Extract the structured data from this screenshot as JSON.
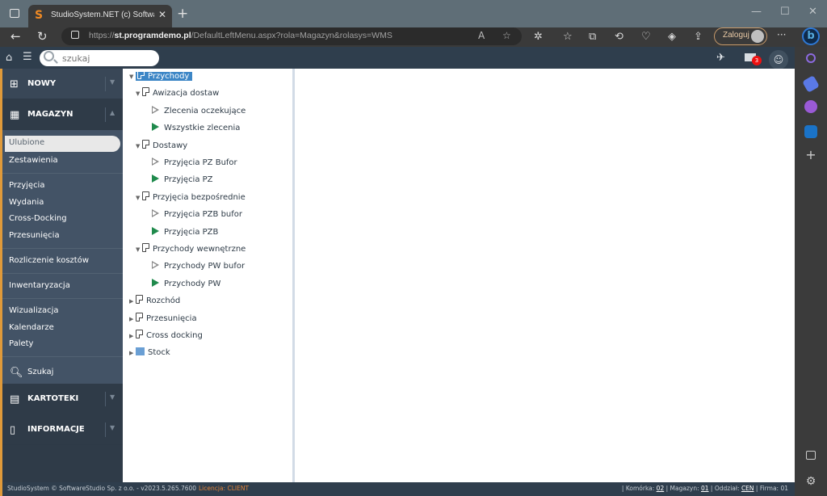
{
  "browser": {
    "tab_title": "StudioSystem.NET (c) SoftwareSt",
    "url_scheme": "https://",
    "url_host": "st.programdemo.pl",
    "url_path": "/DefaultLeftMenu.aspx?rola=Magazyn&rolasys=WMS",
    "login_label": "Zaloguj"
  },
  "app": {
    "search_placeholder": "szukaj",
    "mail_count": "3"
  },
  "menu": {
    "sections": {
      "nowy": "NOWY",
      "magazyn": "MAGAZYN",
      "szukaj": "Szukaj",
      "kartoteki": "KARTOTEKI",
      "informacje": "INFORMACJE"
    },
    "items": [
      "Ulubione",
      "Zestawienia",
      "Przyjęcia",
      "Wydania",
      "Cross-Docking",
      "Przesunięcia",
      "Rozliczenie kosztów",
      "Inwentaryzacja",
      "Wizualizacja",
      "Kalendarze",
      "Palety"
    ]
  },
  "tree": [
    {
      "label": "Przychody",
      "type": "folder",
      "level": 0,
      "expanded": true,
      "selected": true
    },
    {
      "label": "Awizacja dostaw",
      "type": "folder",
      "level": 1,
      "expanded": true
    },
    {
      "label": "Zlecenia oczekujące",
      "type": "open",
      "level": 2
    },
    {
      "label": "Wszystkie zlecenia",
      "type": "filled",
      "level": 2
    },
    {
      "label": "Dostawy",
      "type": "folder",
      "level": 1,
      "expanded": true
    },
    {
      "label": "Przyjęcia PZ Bufor",
      "type": "open",
      "level": 2
    },
    {
      "label": "Przyjęcia PZ",
      "type": "filled",
      "level": 2
    },
    {
      "label": "Przyjęcia bezpośrednie",
      "type": "folder",
      "level": 1,
      "expanded": true
    },
    {
      "label": "Przyjęcia PZB bufor",
      "type": "open",
      "level": 2
    },
    {
      "label": "Przyjęcia PZB",
      "type": "filled",
      "level": 2
    },
    {
      "label": "Przychody wewnętrzne",
      "type": "folder",
      "level": 1,
      "expanded": true
    },
    {
      "label": "Przychody PW bufor",
      "type": "open",
      "level": 2
    },
    {
      "label": "Przychody PW",
      "type": "filled",
      "level": 2
    },
    {
      "label": "Rozchód",
      "type": "folder",
      "level": 0,
      "expanded": false
    },
    {
      "label": "Przesunięcia",
      "type": "folder",
      "level": 0,
      "expanded": false
    },
    {
      "label": "Cross docking",
      "type": "folder",
      "level": 0,
      "expanded": false
    },
    {
      "label": "Stock",
      "type": "stock",
      "level": 0,
      "expanded": false
    }
  ],
  "footer": {
    "copyright": "StudioSystem © SoftwareStudio Sp. z o.o. - v2023.5.265.7600",
    "license": "Licencja: CLIENT",
    "komorka_label": "Komórka:",
    "komorka": "02",
    "magazyn_label": "Magazyn:",
    "magazyn": "01",
    "oddzial_label": "Oddział:",
    "oddzial": "CEN",
    "firma_label": "Firma:",
    "firma": "01"
  }
}
